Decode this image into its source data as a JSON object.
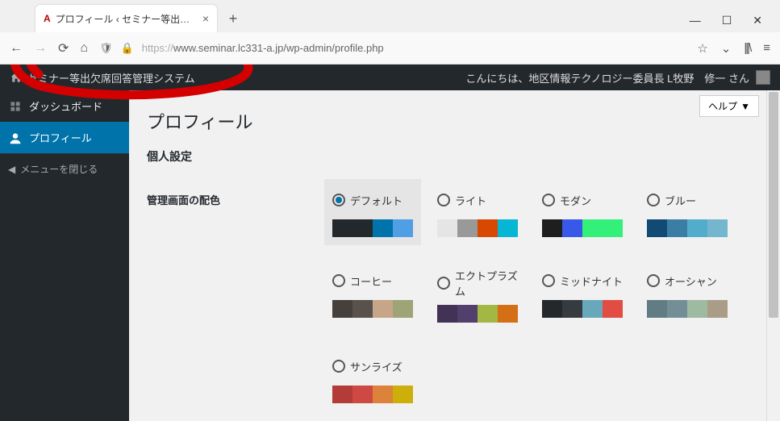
{
  "browser": {
    "tab_title": "プロフィール ‹ セミナー等出欠席回答",
    "url_display": "www.seminar.lc331-a.jp/wp-admin/profile.php",
    "url_https": "https://"
  },
  "adminbar": {
    "site_name": "セミナー等出欠席回答管理システム",
    "greeting": "こんにちは、地区情報テクノロジー委員長 L牧野　修一 さん"
  },
  "sidebar": {
    "dashboard": "ダッシュボード",
    "profile": "プロフィール",
    "collapse": "メニューを閉じる"
  },
  "content": {
    "help": "ヘルプ",
    "page_title": "プロフィール",
    "section_personal": "個人設定",
    "label_colors": "管理画面の配色",
    "schemes": {
      "default": {
        "name": "デフォルト",
        "colors": [
          "#23282d",
          "#23282d",
          "#0073aa",
          "#509ee3"
        ],
        "selected": true
      },
      "light": {
        "name": "ライト",
        "colors": [
          "#e5e5e5",
          "#999999",
          "#d84800",
          "#06b6d4"
        ],
        "selected": false
      },
      "modern": {
        "name": "モダン",
        "colors": [
          "#1e1e1e",
          "#3858e9",
          "#33f078",
          "#33f078"
        ],
        "selected": false
      },
      "blue": {
        "name": "ブルー",
        "colors": [
          "#114a72",
          "#3a7ea6",
          "#52accc",
          "#74B6CE"
        ],
        "selected": false
      },
      "coffee": {
        "name": "コーヒー",
        "colors": [
          "#46403c",
          "#59524c",
          "#c7a589",
          "#9ea476"
        ],
        "selected": false
      },
      "ectoplasm": {
        "name": "エクトプラズム",
        "colors": [
          "#413256",
          "#523f6d",
          "#a3b745",
          "#d46f15"
        ],
        "selected": false
      },
      "midnight": {
        "name": "ミッドナイト",
        "colors": [
          "#25282b",
          "#363b3f",
          "#69a8bb",
          "#e14d43"
        ],
        "selected": false
      },
      "ocean": {
        "name": "オーシャン",
        "colors": [
          "#627c83",
          "#738e96",
          "#9ebaa0",
          "#aa9d88"
        ],
        "selected": false
      },
      "sunrise": {
        "name": "サンライズ",
        "colors": [
          "#b43c38",
          "#cf4944",
          "#dd823b",
          "#ccaf0b"
        ],
        "selected": false
      }
    }
  }
}
